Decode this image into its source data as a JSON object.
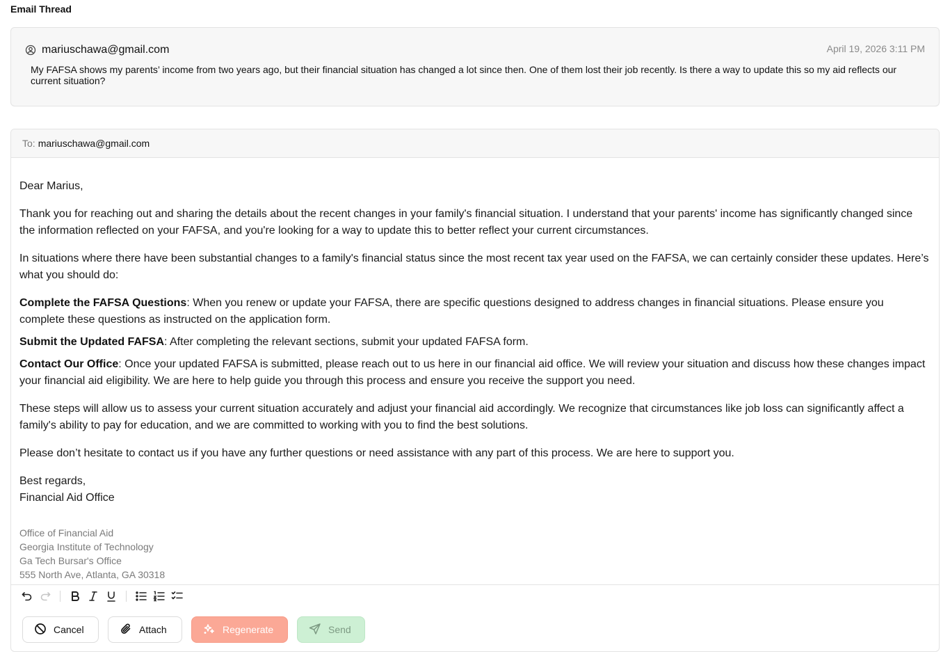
{
  "section_title": "Email Thread",
  "incoming": {
    "sender": "mariuschawa@gmail.com",
    "date": "April 19, 2026 3:11 PM",
    "body": "My FAFSA shows my parents’ income from two years ago, but their financial situation has changed a lot since then. One of them lost their job recently. Is there a way to update this so my aid reflects our current situation?"
  },
  "compose": {
    "to_label": "To:",
    "to_value": "mariuschawa@gmail.com",
    "greeting": "Dear Marius,",
    "para1": "Thank you for reaching out and sharing the details about the recent changes in your family's financial situation. I understand that your parents' income has significantly changed since the information reflected on your FAFSA, and you're looking for a way to update this to better reflect your current circumstances.",
    "para2": "In situations where there have been substantial changes to a family's financial status since the most recent tax year used on the FAFSA, we can certainly consider these updates. Here’s what you should do:",
    "step1_title": "Complete the FAFSA Questions",
    "step1_text": ": When you renew or update your FAFSA, there are specific questions designed to address changes in financial situations. Please ensure you complete these questions as instructed on the application form.",
    "step2_title": "Submit the Updated FAFSA",
    "step2_text": ": After completing the relevant sections, submit your updated FAFSA form.",
    "step3_title": "Contact Our Office",
    "step3_text": ": Once your updated FAFSA is submitted, please reach out to us here in our financial aid office. We will review your situation and discuss how these changes impact your financial aid eligibility. We are here to help guide you through this process and ensure you receive the support you need.",
    "para3": "These steps will allow us to assess your current situation accurately and adjust your financial aid accordingly. We recognize that circumstances like job loss can significantly affect a family's ability to pay for education, and we are committed to working with you to find the best solutions.",
    "para4": "Please don’t hesitate to contact us if you have any further questions or need assistance with any part of this process. We are here to support you.",
    "closing": "Best regards,",
    "closing_name": "Financial Aid Office",
    "signature": [
      "Office of Financial Aid",
      "Georgia Institute of Technology",
      "Ga Tech Bursar's Office",
      "555 North Ave, Atlanta, GA 30318"
    ]
  },
  "toolbar": {
    "icons": [
      "undo-icon",
      "redo-icon",
      "bold-icon",
      "italic-icon",
      "underline-icon",
      "bullet-list-icon",
      "numbered-list-icon",
      "checklist-icon"
    ]
  },
  "actions": {
    "cancel_label": "Cancel",
    "attach_label": "Attach",
    "regenerate_label": "Regenerate",
    "send_label": "Send"
  },
  "colors": {
    "regenerate_bg": "#fba896",
    "send_bg": "#cdf0d4",
    "card_bg": "#f7f7f7"
  }
}
